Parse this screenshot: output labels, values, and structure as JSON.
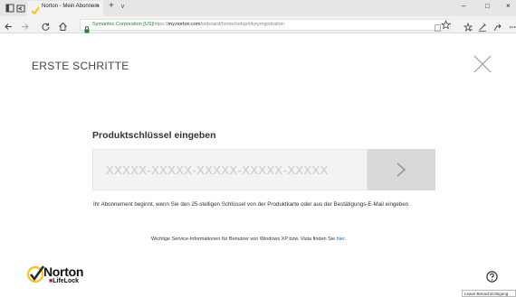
{
  "browser": {
    "tab_title": "Norton - Mein Abonnem",
    "tab_close": "×",
    "new_tab": "+",
    "tab_list": "∨",
    "window": {
      "minimize": "–",
      "maximize": "□",
      "close": "×"
    },
    "url": {
      "org": "Symantec Corporation [US]",
      "prefix": "https://",
      "domain": "my.norton.com",
      "path": "/onboard/home/setup#/keyregistration"
    }
  },
  "page": {
    "title": "ERSTE SCHRITTE",
    "heading": "Produktschlüssel eingeben",
    "key_placeholder": "XXXXX-XXXXX-XXXXX-XXXXX-XXXXX",
    "info_text": "Ihr Abonnement beginnt, wenn Sie den 25-stelligen Schlüssel von der Produktkarte oder aus der Bestätigungs-E-Mail eingeben.",
    "xp_text": "Wichtige Service-Informationen für Benutzer von Windows XP bzw. Vista finden Sie",
    "xp_link": "hier",
    "xp_end": "."
  },
  "footer": {
    "logo_name": "Norton",
    "logo_sub_a": "■",
    "logo_sub_b": "LifeLock",
    "tooltip": "Leave Benachrichtigung"
  },
  "colors": {
    "accent_yellow": "#ffc20e",
    "link": "#0a6fc2",
    "secure_green": "#2e7d32",
    "lifelock_red": "#c8102e"
  }
}
